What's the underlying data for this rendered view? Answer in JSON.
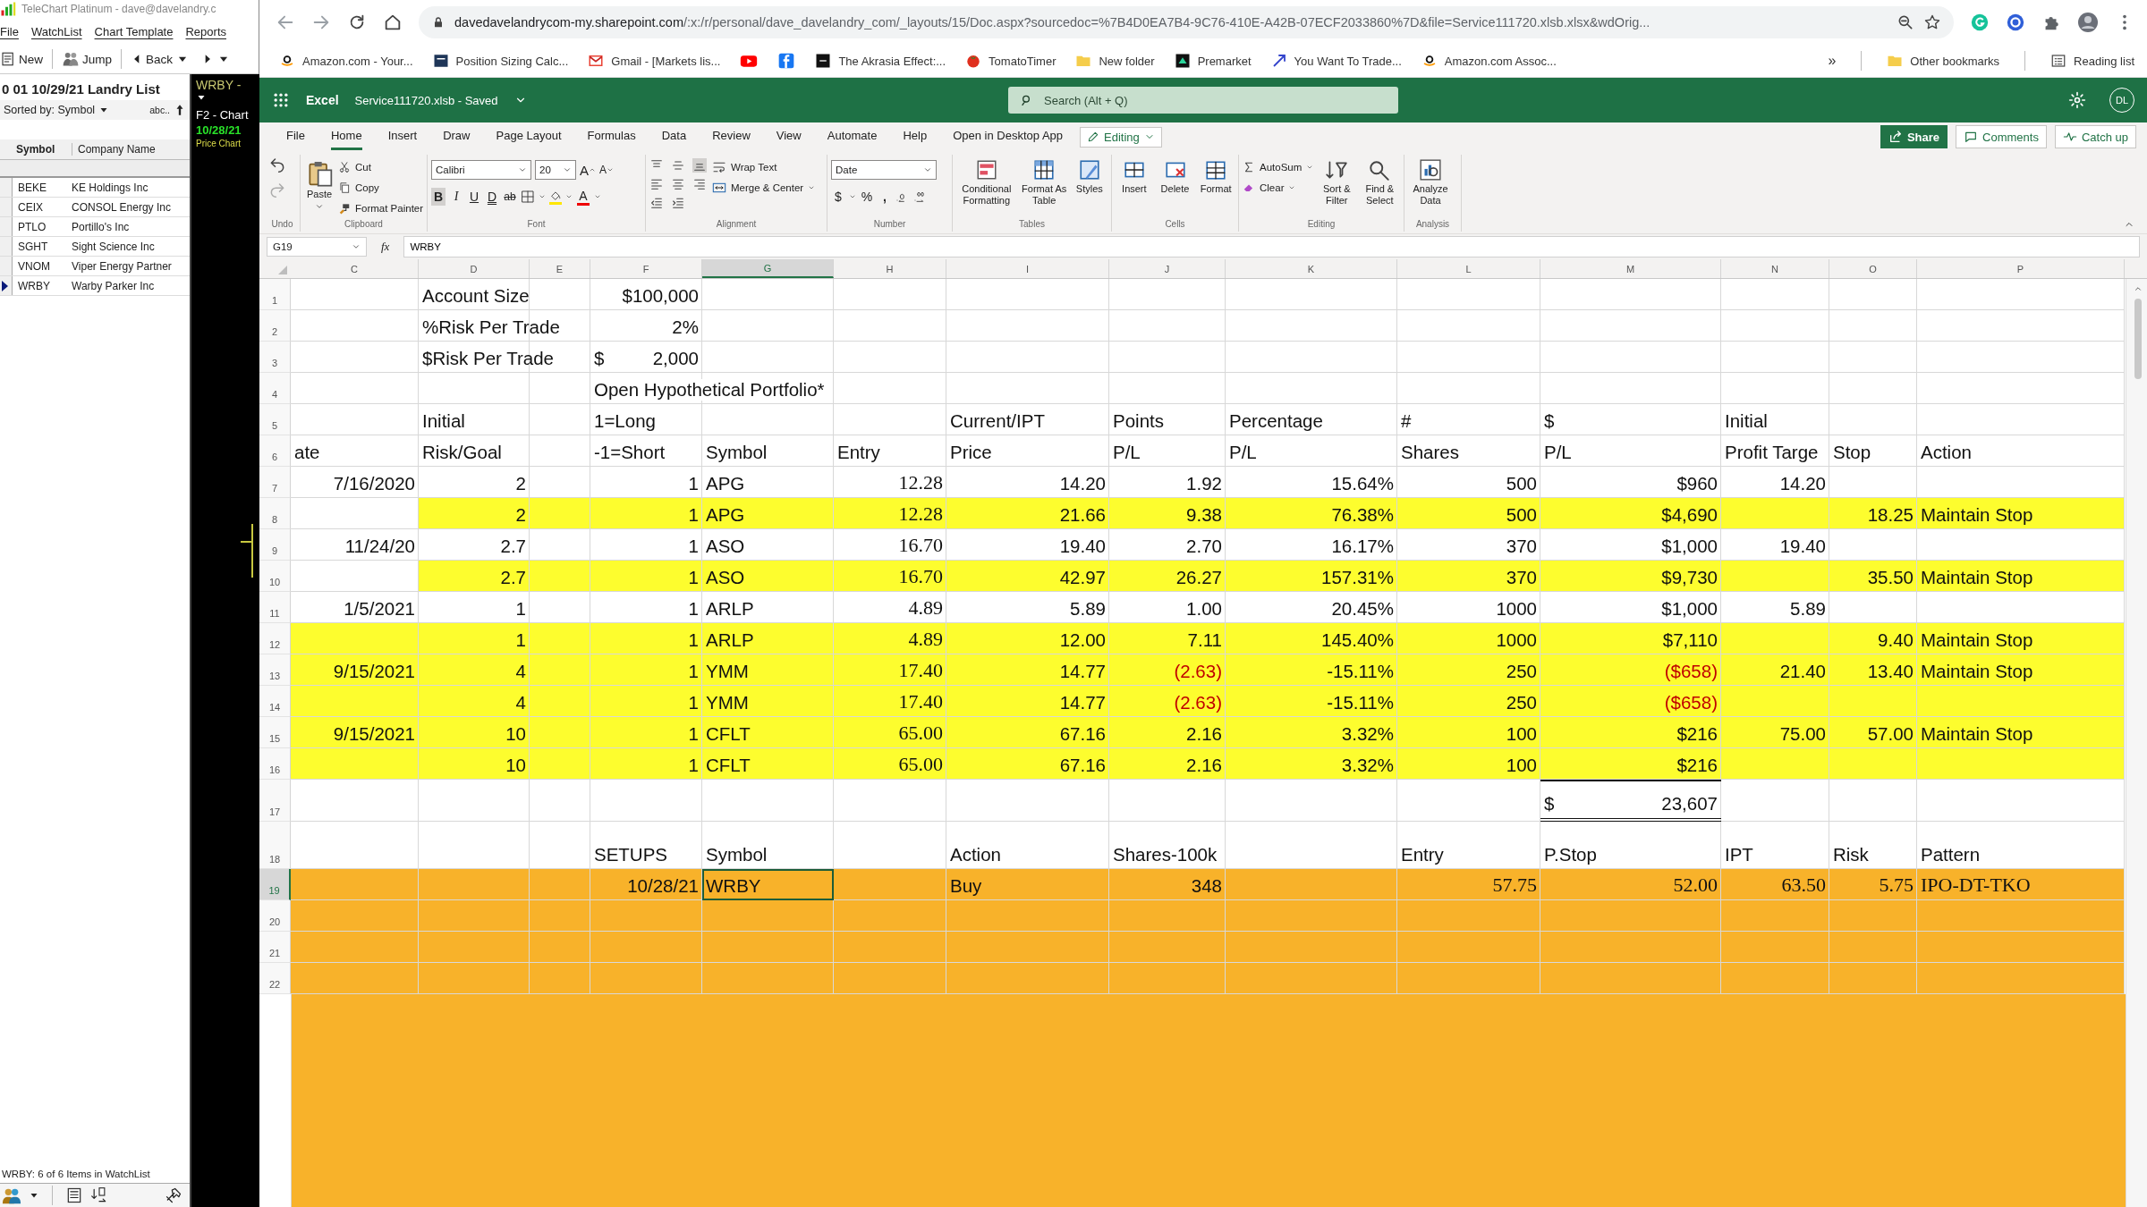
{
  "telechart": {
    "title": "TeleChart Platinum - dave@davelandry.c",
    "menu": [
      "File",
      "WatchList",
      "Chart Template",
      "Reports"
    ],
    "toolbar": [
      "New",
      "Jump",
      "Back"
    ],
    "list_title": "0 01 10/29/21 Landry List",
    "sort_label": "Sorted by: Symbol",
    "sort_order": "abc..",
    "columns": [
      "Symbol",
      "Company Name"
    ],
    "rows": [
      {
        "symbol": "BEKE",
        "company": "KE Holdings Inc",
        "selected": false
      },
      {
        "symbol": "CEIX",
        "company": "CONSOL Energy Inc",
        "selected": false
      },
      {
        "symbol": "PTLO",
        "company": "Portillo's Inc",
        "selected": false
      },
      {
        "symbol": "SGHT",
        "company": "Sight Science Inc",
        "selected": false
      },
      {
        "symbol": "VNOM",
        "company": "Viper Energy Partner",
        "selected": false
      },
      {
        "symbol": "WRBY",
        "company": "Warby Parker Inc",
        "selected": true
      }
    ],
    "status": "WRBY: 6 of 6 Items in WatchList"
  },
  "chart_panel": {
    "symbol": "WRBY -",
    "shortcut": "F2 - Chart",
    "date": "10/28/21",
    "type": "Price Chart"
  },
  "browser": {
    "url_host": "davedavelandrycom-my.sharepoint.com",
    "url_path": "/:x:/r/personal/dave_davelandry_com/_layouts/15/Doc.aspx?sourcedoc=%7B4D0EA7B4-9C76-410E-A42B-07ECF2033860%7D&file=Service111720.xlsb.xlsx&wdOrig...",
    "bookmarks": [
      {
        "kind": "link",
        "label": "Amazon.com - Your..."
      },
      {
        "kind": "link",
        "label": "Position Sizing Calc..."
      },
      {
        "kind": "link",
        "label": "Gmail - [Markets lis..."
      },
      {
        "kind": "icon_only"
      },
      {
        "kind": "icon_only"
      },
      {
        "kind": "link",
        "label": "The Akrasia Effect:..."
      },
      {
        "kind": "link",
        "label": "TomatoTimer"
      },
      {
        "kind": "link",
        "label": "New folder"
      },
      {
        "kind": "link",
        "label": "Premarket"
      },
      {
        "kind": "link",
        "label": "You Want To Trade..."
      },
      {
        "kind": "link",
        "label": "Amazon.com Assoc..."
      }
    ],
    "overflow": "»",
    "other_bookmarks": "Other bookmarks",
    "reading_list": "Reading list"
  },
  "excel": {
    "app": "Excel",
    "file": "Service111720.xlsb - Saved",
    "search": {
      "placeholder": "Search (Alt + Q)"
    },
    "user": "DL",
    "tabs": [
      {
        "label": "File",
        "selected": false
      },
      {
        "label": "Home",
        "selected": true
      },
      {
        "label": "Insert",
        "selected": false
      },
      {
        "label": "Draw",
        "selected": false
      },
      {
        "label": "Page Layout",
        "selected": false
      },
      {
        "label": "Formulas",
        "selected": false
      },
      {
        "label": "Data",
        "selected": false
      },
      {
        "label": "Review",
        "selected": false
      },
      {
        "label": "View",
        "selected": false
      },
      {
        "label": "Automate",
        "selected": false
      },
      {
        "label": "Help",
        "selected": false
      }
    ],
    "open_desktop": "Open in Desktop App",
    "mode": "Editing",
    "actions": [
      "Share",
      "Comments",
      "Catch up"
    ],
    "ribbon": {
      "groups": [
        "Undo",
        "Clipboard",
        "Font",
        "Alignment",
        "Number",
        "Tables",
        "Cells",
        "Editing",
        "Analysis"
      ],
      "paste": "Paste",
      "cut": "Cut",
      "copy": "Copy",
      "format_painter": "Format Painter",
      "font": "Calibri",
      "font_size": "20",
      "grow": "A",
      "shrink": "A",
      "bold": "B",
      "italic": "I",
      "underline": "U",
      "double_underline": "D",
      "strikethrough": "ab",
      "font_color": "A",
      "wrap_text": "Wrap Text",
      "merge": "Merge & Center",
      "number_format": "Date",
      "currency": "$",
      "percent": "%",
      "comma": ",",
      "conditional": "Conditional Formatting",
      "format_table": "Format As Table",
      "styles": "Styles",
      "insert": "Insert",
      "delete": "Delete",
      "format": "Format",
      "autosum": "AutoSum",
      "clear": "Clear",
      "sort": "Sort & Filter",
      "find": "Find & Select",
      "analyze": "Analyze Data"
    },
    "name_box": "G19",
    "function_label": "fx",
    "formula": "WRBY",
    "columns": [
      {
        "letter": "C",
        "selected": false
      },
      {
        "letter": "D",
        "selected": false
      },
      {
        "letter": "E",
        "selected": false
      },
      {
        "letter": "F",
        "selected": false
      },
      {
        "letter": "G",
        "selected": true
      },
      {
        "letter": "H",
        "selected": false
      },
      {
        "letter": "I",
        "selected": false
      },
      {
        "letter": "J",
        "selected": false
      },
      {
        "letter": "K",
        "selected": false
      },
      {
        "letter": "L",
        "selected": false
      },
      {
        "letter": "M",
        "selected": false
      },
      {
        "letter": "N",
        "selected": false
      },
      {
        "letter": "O",
        "selected": false
      },
      {
        "letter": "P",
        "selected": false
      }
    ],
    "rows": [
      {
        "number": "1",
        "kind": "info",
        "selected": false,
        "cells": [
          null,
          "Account Size",
          null,
          "$100,000"
        ]
      },
      {
        "number": "2",
        "kind": "info",
        "selected": false,
        "cells": [
          null,
          "%Risk Per Trade",
          null,
          "2%"
        ]
      },
      {
        "number": "3",
        "kind": "info",
        "selected": false,
        "cells": [
          null,
          "$Risk Per Trade",
          null,
          {
            "symbol": "$",
            "text": "2,000"
          }
        ]
      },
      {
        "number": "4",
        "kind": "title",
        "selected": false,
        "cells": [
          null,
          null,
          null,
          "Open Hypothetical Portfolio*"
        ]
      },
      {
        "number": "5",
        "kind": "header",
        "selected": false,
        "cells": [
          null,
          "Initial",
          null,
          "1=Long",
          null,
          null,
          "Current/IPT",
          "Points",
          "Percentage",
          "#",
          "$",
          "Initial"
        ]
      },
      {
        "number": "6",
        "kind": "header",
        "selected": false,
        "cells": [
          "ate",
          "Risk/Goal",
          null,
          "-1=Short",
          "Symbol",
          "Entry",
          "Price",
          "P/L",
          "P/L",
          "Shares",
          "P/L",
          "Profit Targe",
          "Stop",
          "Action"
        ]
      },
      {
        "number": "7",
        "kind": "data",
        "selected": false,
        "cells": [
          "7/16/2020",
          "2",
          null,
          "1",
          "APG",
          "12.28",
          "14.20",
          "1.92",
          "15.64%",
          "500",
          "$960",
          "14.20"
        ]
      },
      {
        "number": "8",
        "kind": "data",
        "color": "#fdfd2e",
        "fill_first_column": false,
        "selected": false,
        "cells": [
          null,
          "2",
          null,
          "1",
          "APG",
          "12.28",
          "21.66",
          "9.38",
          "76.38%",
          "500",
          "$4,690",
          null,
          "18.25",
          "Maintain Stop"
        ]
      },
      {
        "number": "9",
        "kind": "data",
        "selected": false,
        "cells": [
          "11/24/20",
          "2.7",
          null,
          "1",
          "ASO",
          "16.70",
          "19.40",
          "2.70",
          "16.17%",
          "370",
          "$1,000",
          "19.40"
        ]
      },
      {
        "number": "10",
        "kind": "data",
        "color": "#fdfd2e",
        "fill_first_column": false,
        "selected": false,
        "cells": [
          null,
          "2.7",
          null,
          "1",
          "ASO",
          "16.70",
          "42.97",
          "26.27",
          "157.31%",
          "370",
          "$9,730",
          null,
          "35.50",
          "Maintain Stop"
        ]
      },
      {
        "number": "11",
        "kind": "data",
        "selected": false,
        "cells": [
          "1/5/2021",
          "1",
          null,
          "1",
          "ARLP",
          "4.89",
          "5.89",
          "1.00",
          "20.45%",
          "1000",
          "$1,000",
          "5.89"
        ]
      },
      {
        "number": "12",
        "kind": "data",
        "color": "#fdfd2e",
        "fill_first_column": true,
        "selected": false,
        "cells": [
          null,
          "1",
          null,
          "1",
          "ARLP",
          "4.89",
          "12.00",
          "7.11",
          "145.40%",
          "1000",
          "$7,110",
          null,
          "9.40",
          "Maintain Stop"
        ]
      },
      {
        "number": "13",
        "kind": "data",
        "color": "#fdfd2e",
        "fill_first_column": true,
        "selected": false,
        "cells": [
          "9/15/2021",
          "4",
          null,
          "1",
          "YMM",
          "17.40",
          "14.77",
          {
            "text": "(2.63)",
            "negative": true
          },
          "-15.11%",
          "250",
          {
            "text": "($658)",
            "negative": true
          },
          "21.40",
          "13.40",
          "Maintain Stop"
        ]
      },
      {
        "number": "14",
        "kind": "data",
        "color": "#fdfd2e",
        "fill_first_column": true,
        "selected": false,
        "cells": [
          null,
          "4",
          null,
          "1",
          "YMM",
          "17.40",
          "14.77",
          {
            "text": "(2.63)",
            "negative": true
          },
          "-15.11%",
          "250",
          {
            "text": "($658)",
            "negative": true
          }
        ]
      },
      {
        "number": "15",
        "kind": "data",
        "color": "#fdfd2e",
        "fill_first_column": true,
        "selected": false,
        "cells": [
          "9/15/2021",
          "10",
          null,
          "1",
          "CFLT",
          "65.00",
          "67.16",
          "2.16",
          "3.32%",
          "100",
          "$216",
          "75.00",
          "57.00",
          "Maintain Stop"
        ]
      },
      {
        "number": "16",
        "kind": "data",
        "color": "#fdfd2e",
        "fill_first_column": true,
        "selected": false,
        "cells": [
          null,
          "10",
          null,
          "1",
          "CFLT",
          "65.00",
          "67.16",
          "2.16",
          "3.32%",
          "100",
          "$216"
        ]
      },
      {
        "number": "17",
        "kind": "data",
        "selected": false,
        "cells": [
          null,
          null,
          null,
          null,
          null,
          null,
          null,
          null,
          null,
          null,
          {
            "symbol": "$",
            "text": "23,607",
            "kind": "total"
          }
        ]
      },
      {
        "number": "18",
        "kind": "header",
        "selected": false,
        "cells": [
          null,
          null,
          null,
          "SETUPS",
          "Symbol",
          null,
          "Action",
          "Shares-100k",
          null,
          "Entry",
          "P.Stop",
          "IPT",
          "Risk",
          "Pattern"
        ]
      },
      {
        "number": "19",
        "kind": "setup",
        "color": "#f8b22a",
        "fill_first_column": true,
        "selected": true,
        "cells": [
          null,
          null,
          null,
          "10/28/21",
          {
            "text": "WRBY",
            "selected": true
          },
          null,
          "Buy",
          "348",
          null,
          "57.75",
          "52.00",
          "63.50",
          "5.75",
          "IPO-DT-TKO"
        ]
      },
      {
        "number": "20",
        "kind": "data",
        "color": "#f8b22a",
        "fill_first_column": true,
        "selected": false
      },
      {
        "number": "21",
        "kind": "data",
        "color": "#f8b22a",
        "fill_first_column": true,
        "selected": false
      },
      {
        "number": "22",
        "kind": "data",
        "color": "#f8b22a",
        "fill_first_column": true,
        "selected": false
      }
    ]
  }
}
